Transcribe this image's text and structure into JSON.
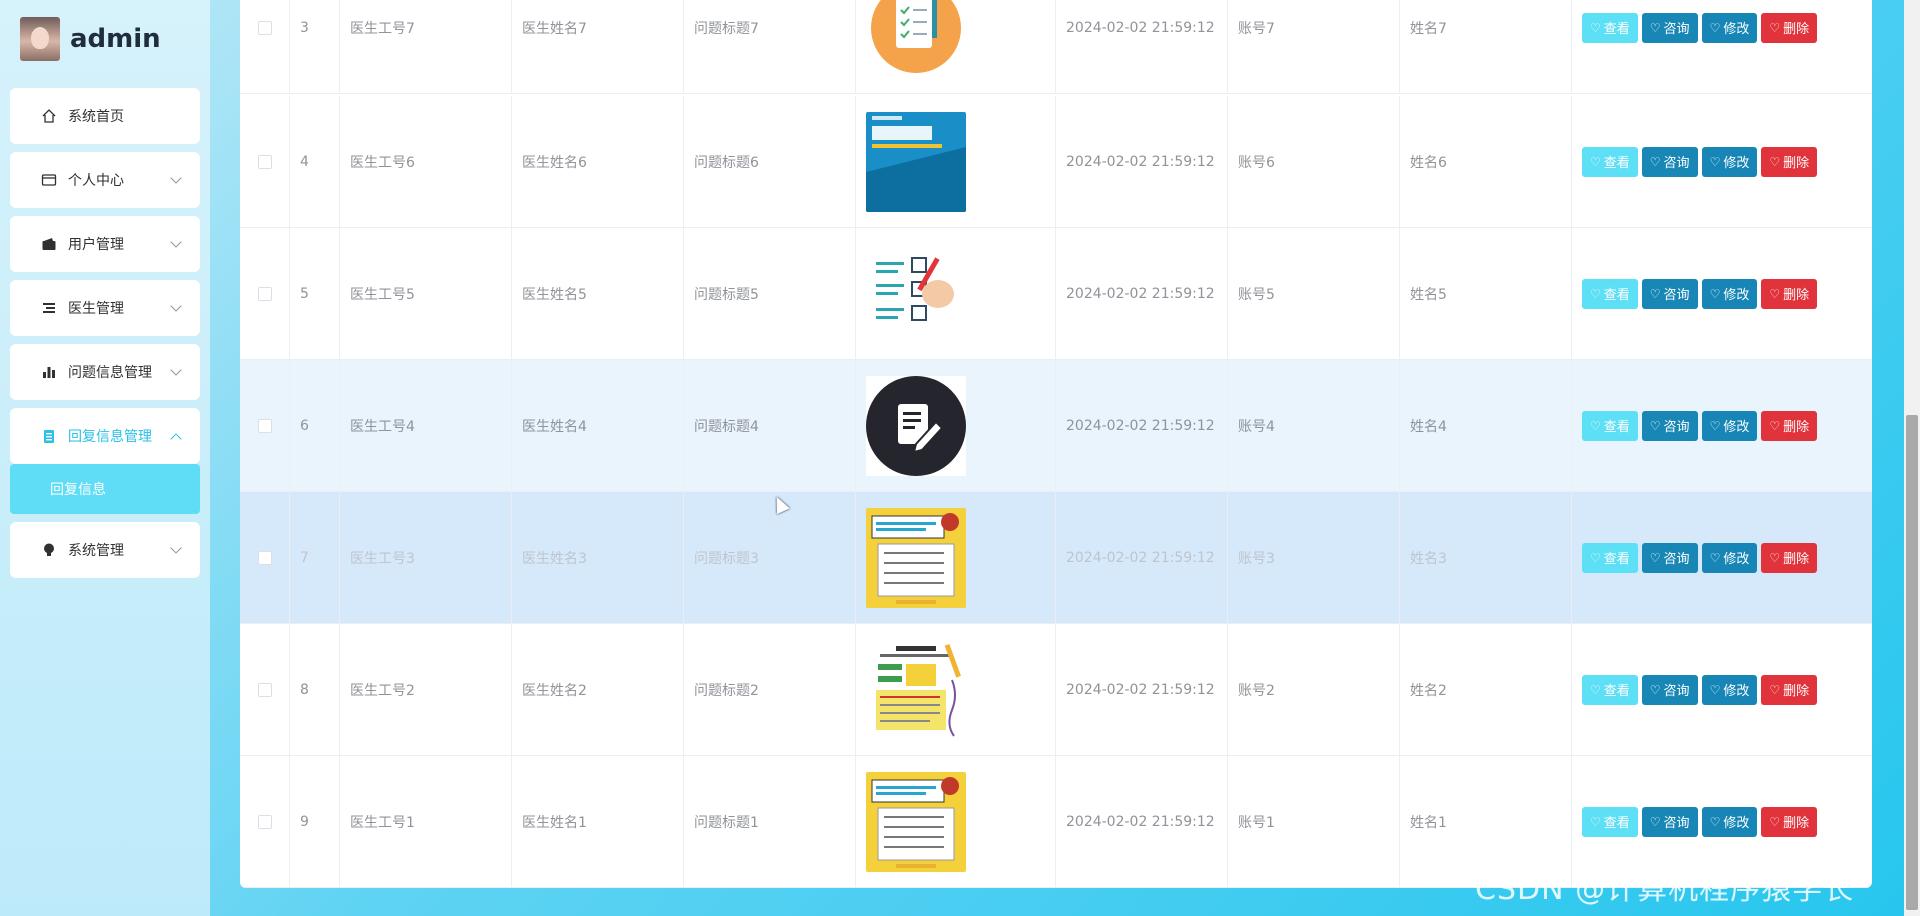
{
  "brand": {
    "name": "admin"
  },
  "sidebar": {
    "items": [
      {
        "label": "系统首页",
        "icon": "home-icon"
      },
      {
        "label": "个人中心",
        "icon": "card-icon"
      },
      {
        "label": "用户管理",
        "icon": "wallet-icon"
      },
      {
        "label": "医生管理",
        "icon": "list-icon"
      },
      {
        "label": "问题信息管理",
        "icon": "bar-chart-icon"
      },
      {
        "label": "回复信息管理",
        "icon": "document-icon"
      },
      {
        "label": "系统管理",
        "icon": "bulb-icon"
      }
    ],
    "submenu": {
      "label": "回复信息"
    }
  },
  "table": {
    "rows": [
      {
        "idx": "3",
        "doctor_id": "医生工号7",
        "doctor_name": "医生姓名7",
        "title": "问题标题7",
        "time": "2024-02-02 21:59:12",
        "account": "账号7",
        "name": "姓名7",
        "image": "checklist-clipboard"
      },
      {
        "idx": "4",
        "doctor_id": "医生工号6",
        "doctor_name": "医生姓名6",
        "title": "问题标题6",
        "time": "2024-02-02 21:59:12",
        "account": "账号6",
        "name": "姓名6",
        "image": "blue-form"
      },
      {
        "idx": "5",
        "doctor_id": "医生工号5",
        "doctor_name": "医生姓名5",
        "title": "问题标题5",
        "time": "2024-02-02 21:59:12",
        "account": "账号5",
        "name": "姓名5",
        "image": "checklist-hand"
      },
      {
        "idx": "6",
        "doctor_id": "医生工号4",
        "doctor_name": "医生姓名4",
        "title": "问题标题4",
        "time": "2024-02-02 21:59:12",
        "account": "账号4",
        "name": "姓名4",
        "image": "dark-edit-circle"
      },
      {
        "idx": "7",
        "doctor_id": "医生工号3",
        "doctor_name": "医生姓名3",
        "title": "问题标题3",
        "time": "2024-02-02 21:59:12",
        "account": "账号3",
        "name": "姓名3",
        "image": "yellow-poster"
      },
      {
        "idx": "8",
        "doctor_id": "医生工号2",
        "doctor_name": "医生姓名2",
        "title": "问题标题2",
        "time": "2024-02-02 21:59:12",
        "account": "账号2",
        "name": "姓名2",
        "image": "survey-poster"
      },
      {
        "idx": "9",
        "doctor_id": "医生工号1",
        "doctor_name": "医生姓名1",
        "title": "问题标题1",
        "time": "2024-02-02 21:59:12",
        "account": "账号1",
        "name": "姓名1",
        "image": "yellow-poster"
      }
    ],
    "actions": {
      "view": "查看",
      "ask": "咨询",
      "edit": "修改",
      "delete": "删除"
    }
  },
  "watermark": "CSDN @计算机程序猿学长",
  "colors": {
    "accent": "#29c1e6",
    "view": "#5ddff5",
    "ask": "#1887b6",
    "delete": "#e0333b"
  }
}
